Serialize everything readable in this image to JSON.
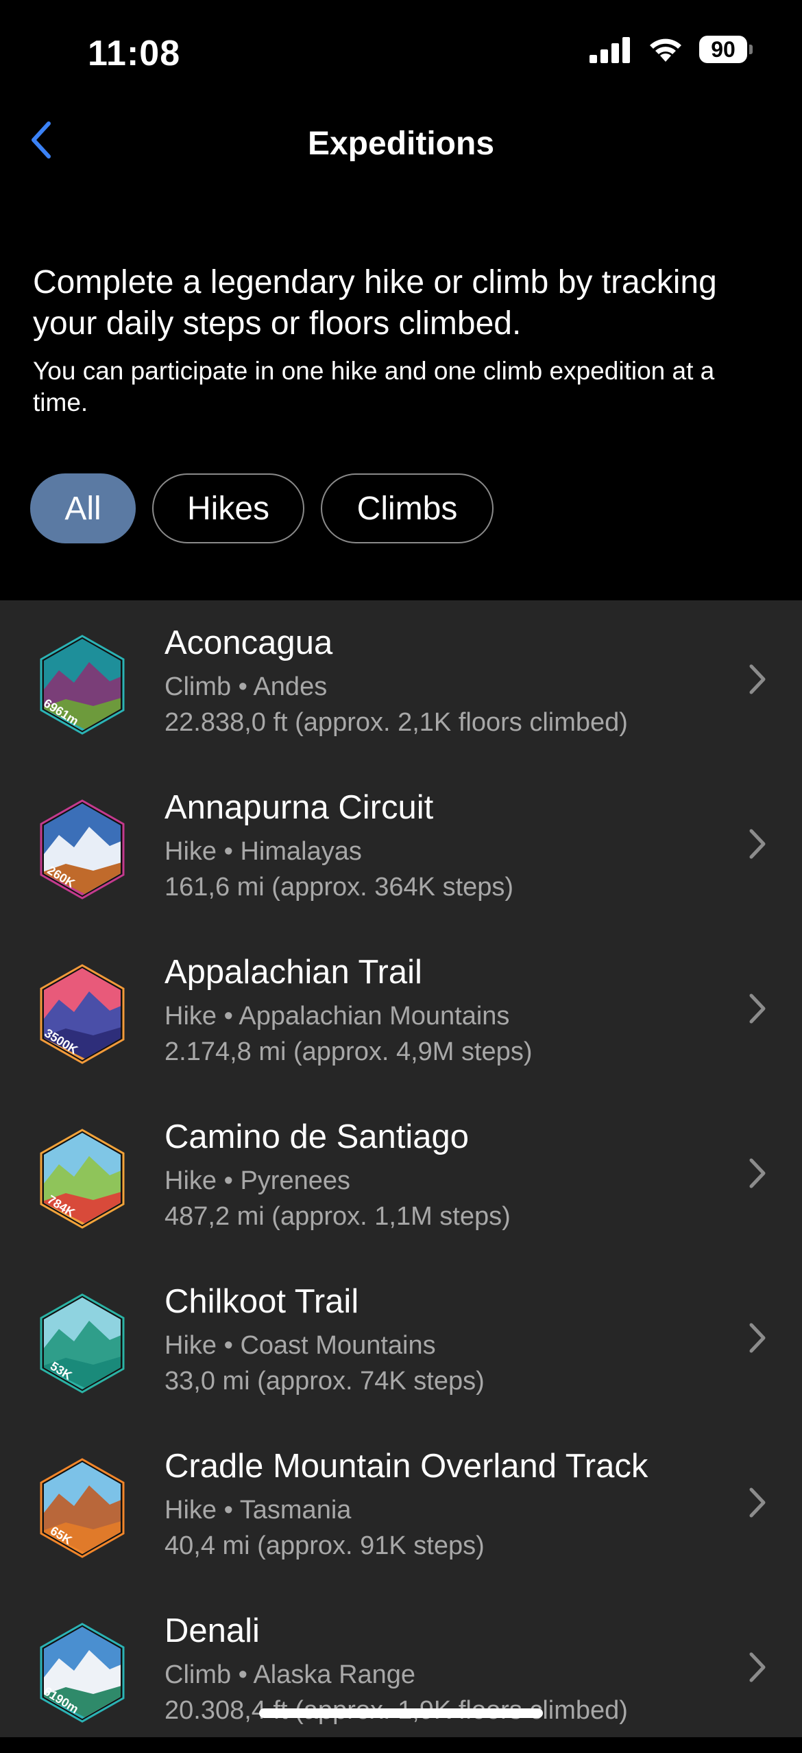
{
  "status_bar": {
    "time": "11:08",
    "battery": "90"
  },
  "nav": {
    "title": "Expeditions",
    "back_icon": "chevron-left-icon"
  },
  "intro": {
    "lead": "Complete a legendary hike or climb by tracking your daily steps or floors climbed.",
    "sub": "You can participate in one hike and one climb expedition at a time."
  },
  "filters": [
    {
      "label": "All",
      "selected": true
    },
    {
      "label": "Hikes",
      "selected": false
    },
    {
      "label": "Climbs",
      "selected": false
    }
  ],
  "colors": {
    "accent": "#5b7aa3",
    "list_bg": "#262626",
    "back_blue": "#3b82f6"
  },
  "expeditions": [
    {
      "name": "Aconcagua",
      "type": "Climb",
      "region": "Andes",
      "detail": "22.838,0 ft (approx. 2,1K floors climbed)",
      "badge_label": "6961m",
      "badge_top": "#1e8f9a",
      "badge_mid": "#7a3e78",
      "badge_bottom": "#6d9a3c",
      "badge_border": "#2bb3b5"
    },
    {
      "name": "Annapurna Circuit",
      "type": "Hike",
      "region": "Himalayas",
      "detail": "161,6 mi (approx. 364K steps)",
      "badge_label": "260K",
      "badge_top": "#3b6fb8",
      "badge_mid": "#e8eef7",
      "badge_bottom": "#c06a2b",
      "badge_border": "#c43a8e"
    },
    {
      "name": "Appalachian Trail",
      "type": "Hike",
      "region": "Appalachian Mountains",
      "detail": "2.174,8 mi (approx. 4,9M steps)",
      "badge_label": "3500K",
      "badge_top": "#e85a7a",
      "badge_mid": "#4a4fa8",
      "badge_bottom": "#2e2e7a",
      "badge_border": "#f29a3a"
    },
    {
      "name": "Camino de Santiago",
      "type": "Hike",
      "region": "Pyrenees",
      "detail": "487,2 mi (approx. 1,1M steps)",
      "badge_label": "784K",
      "badge_top": "#7fc6e6",
      "badge_mid": "#8fc45a",
      "badge_bottom": "#d84a3a",
      "badge_border": "#f2a33a"
    },
    {
      "name": "Chilkoot Trail",
      "type": "Hike",
      "region": "Coast Mountains",
      "detail": "33,0 mi (approx. 74K steps)",
      "badge_label": "53K",
      "badge_top": "#8fd3e0",
      "badge_mid": "#2f9e8a",
      "badge_bottom": "#1a8a7a",
      "badge_border": "#2bb3a5"
    },
    {
      "name": "Cradle Mountain Overland Track",
      "type": "Hike",
      "region": "Tasmania",
      "detail": "40,4 mi (approx. 91K steps)",
      "badge_label": "65K",
      "badge_top": "#7cc2e8",
      "badge_mid": "#b9673a",
      "badge_bottom": "#e07a2a",
      "badge_border": "#f2862a"
    },
    {
      "name": "Denali",
      "type": "Climb",
      "region": "Alaska Range",
      "detail": "20.308,4 ft (approx. 1,9K floors climbed)",
      "badge_label": "6190m",
      "badge_top": "#4a8fd0",
      "badge_mid": "#eef2f7",
      "badge_bottom": "#2f8a6a",
      "badge_border": "#2bb3b5"
    }
  ]
}
